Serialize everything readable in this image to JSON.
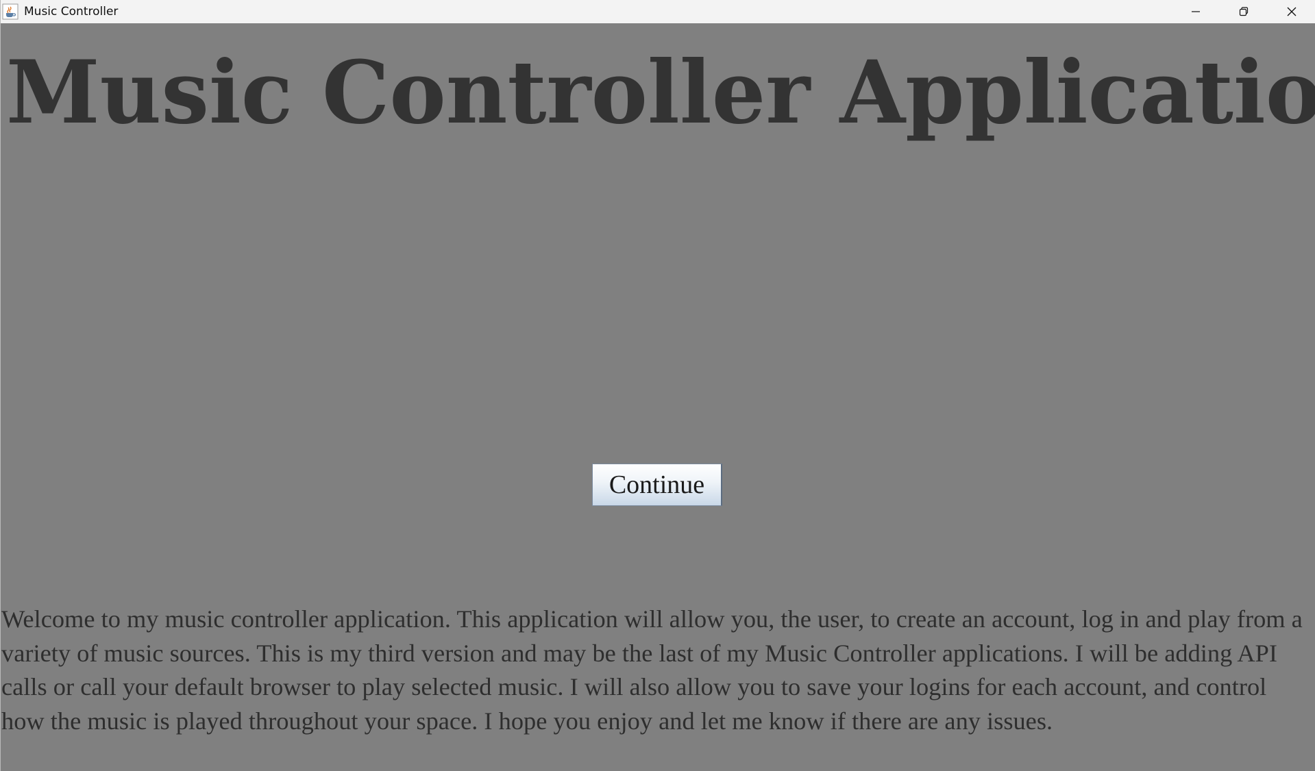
{
  "window": {
    "title": "Music Controller",
    "icon": "java-coffee-cup-icon",
    "controls": {
      "minimize": "minimize-icon",
      "restore": "restore-icon",
      "close": "close-icon"
    }
  },
  "main": {
    "heading": "Music Controller Application",
    "continue_label": "Continue",
    "description": "Welcome to my music controller application. This application will allow you, the user, to create an account, log in and play from a variety of music sources. This is my third version and may be the last of my Music Controller applications. I will be adding API calls or call your default browser to play selected music. I will also allow you to save your logins for each account, and control how the music is played throughout your space. I hope you enjoy and let me know if there are any issues."
  },
  "colors": {
    "background": "#808080",
    "heading_text": "#333333",
    "body_text": "#2e2e2e",
    "titlebar": "#f3f3f3",
    "button_gradient_bottom": "#c9d8e8"
  }
}
